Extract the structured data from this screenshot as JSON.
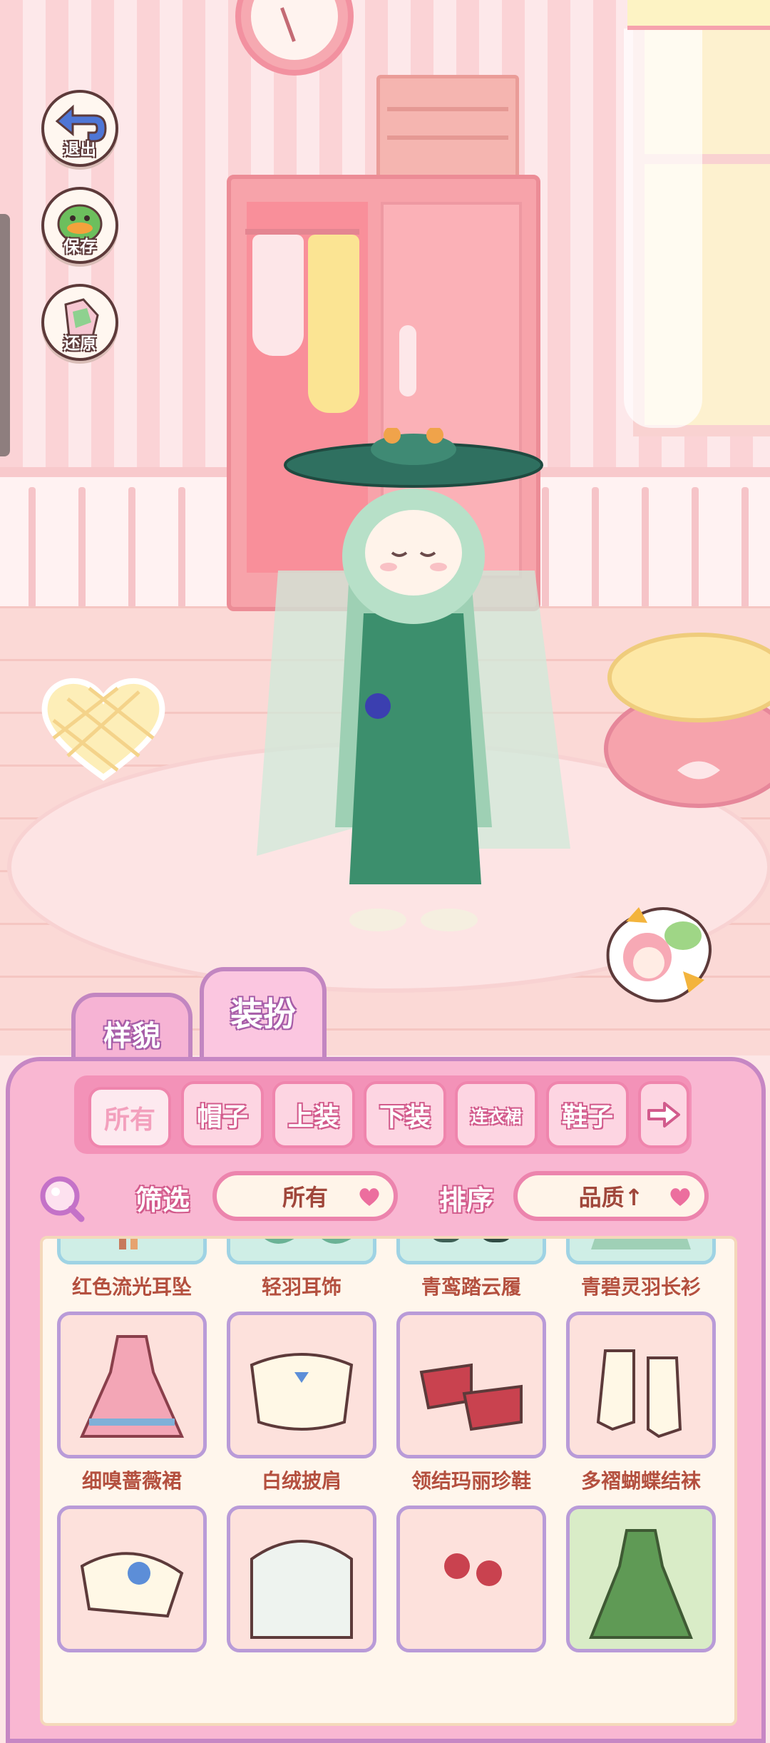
{
  "side_buttons": [
    {
      "id": "exit",
      "label": "退出",
      "icon": "back-arrow-icon"
    },
    {
      "id": "save",
      "label": "保存",
      "icon": "duck-icon"
    },
    {
      "id": "restore",
      "label": "还原",
      "icon": "outfit-reset-icon"
    }
  ],
  "tabs": {
    "appearance": "样貌",
    "dress_up": "装扮"
  },
  "categories": {
    "all": "所有",
    "hat": "帽子",
    "top": "上装",
    "bottom": "下装",
    "dress": "连衣裙",
    "shoes": "鞋子",
    "next_icon": "right-arrow-icon"
  },
  "filter": {
    "label": "筛选",
    "value": "所有"
  },
  "sort": {
    "label": "排序",
    "value": "品质↑"
  },
  "items": [
    {
      "name": "红色流光耳坠"
    },
    {
      "name": "轻羽耳饰"
    },
    {
      "name": "青鸾踏云履"
    },
    {
      "name": "青碧灵羽长衫"
    },
    {
      "name": "细嗅蔷薇裙"
    },
    {
      "name": "白绒披肩"
    },
    {
      "name": "领结玛丽珍鞋"
    },
    {
      "name": "多褶蝴蝶结袜"
    },
    {
      "name": ""
    },
    {
      "name": ""
    },
    {
      "name": ""
    },
    {
      "name": ""
    }
  ],
  "colors": {
    "panel": "#f9b7d2",
    "panel_border": "#c687c4",
    "item_text": "#b4503f",
    "label_outline": "#d25b8c"
  }
}
